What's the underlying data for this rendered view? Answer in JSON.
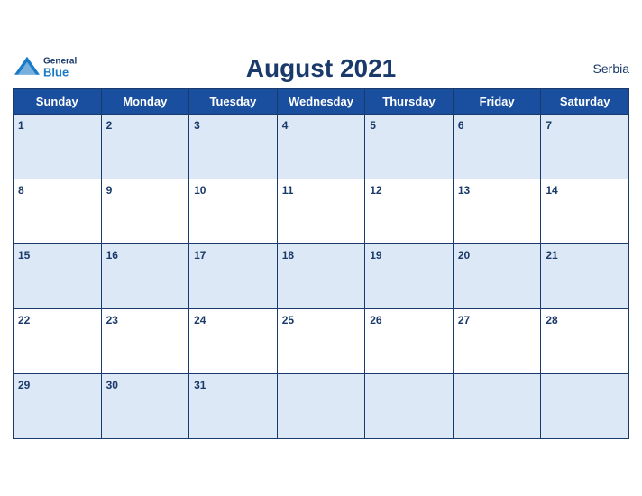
{
  "header": {
    "title": "August 2021",
    "country": "Serbia",
    "logo": {
      "general": "General",
      "blue": "Blue"
    }
  },
  "weekdays": [
    "Sunday",
    "Monday",
    "Tuesday",
    "Wednesday",
    "Thursday",
    "Friday",
    "Saturday"
  ],
  "weeks": [
    [
      {
        "date": "1",
        "empty": false
      },
      {
        "date": "2",
        "empty": false
      },
      {
        "date": "3",
        "empty": false
      },
      {
        "date": "4",
        "empty": false
      },
      {
        "date": "5",
        "empty": false
      },
      {
        "date": "6",
        "empty": false
      },
      {
        "date": "7",
        "empty": false
      }
    ],
    [
      {
        "date": "8",
        "empty": false
      },
      {
        "date": "9",
        "empty": false
      },
      {
        "date": "10",
        "empty": false
      },
      {
        "date": "11",
        "empty": false
      },
      {
        "date": "12",
        "empty": false
      },
      {
        "date": "13",
        "empty": false
      },
      {
        "date": "14",
        "empty": false
      }
    ],
    [
      {
        "date": "15",
        "empty": false
      },
      {
        "date": "16",
        "empty": false
      },
      {
        "date": "17",
        "empty": false
      },
      {
        "date": "18",
        "empty": false
      },
      {
        "date": "19",
        "empty": false
      },
      {
        "date": "20",
        "empty": false
      },
      {
        "date": "21",
        "empty": false
      }
    ],
    [
      {
        "date": "22",
        "empty": false
      },
      {
        "date": "23",
        "empty": false
      },
      {
        "date": "24",
        "empty": false
      },
      {
        "date": "25",
        "empty": false
      },
      {
        "date": "26",
        "empty": false
      },
      {
        "date": "27",
        "empty": false
      },
      {
        "date": "28",
        "empty": false
      }
    ],
    [
      {
        "date": "29",
        "empty": false
      },
      {
        "date": "30",
        "empty": false
      },
      {
        "date": "31",
        "empty": false
      },
      {
        "date": "",
        "empty": true
      },
      {
        "date": "",
        "empty": true
      },
      {
        "date": "",
        "empty": true
      },
      {
        "date": "",
        "empty": true
      }
    ]
  ],
  "row_shading": [
    true,
    false,
    true,
    false,
    true
  ]
}
